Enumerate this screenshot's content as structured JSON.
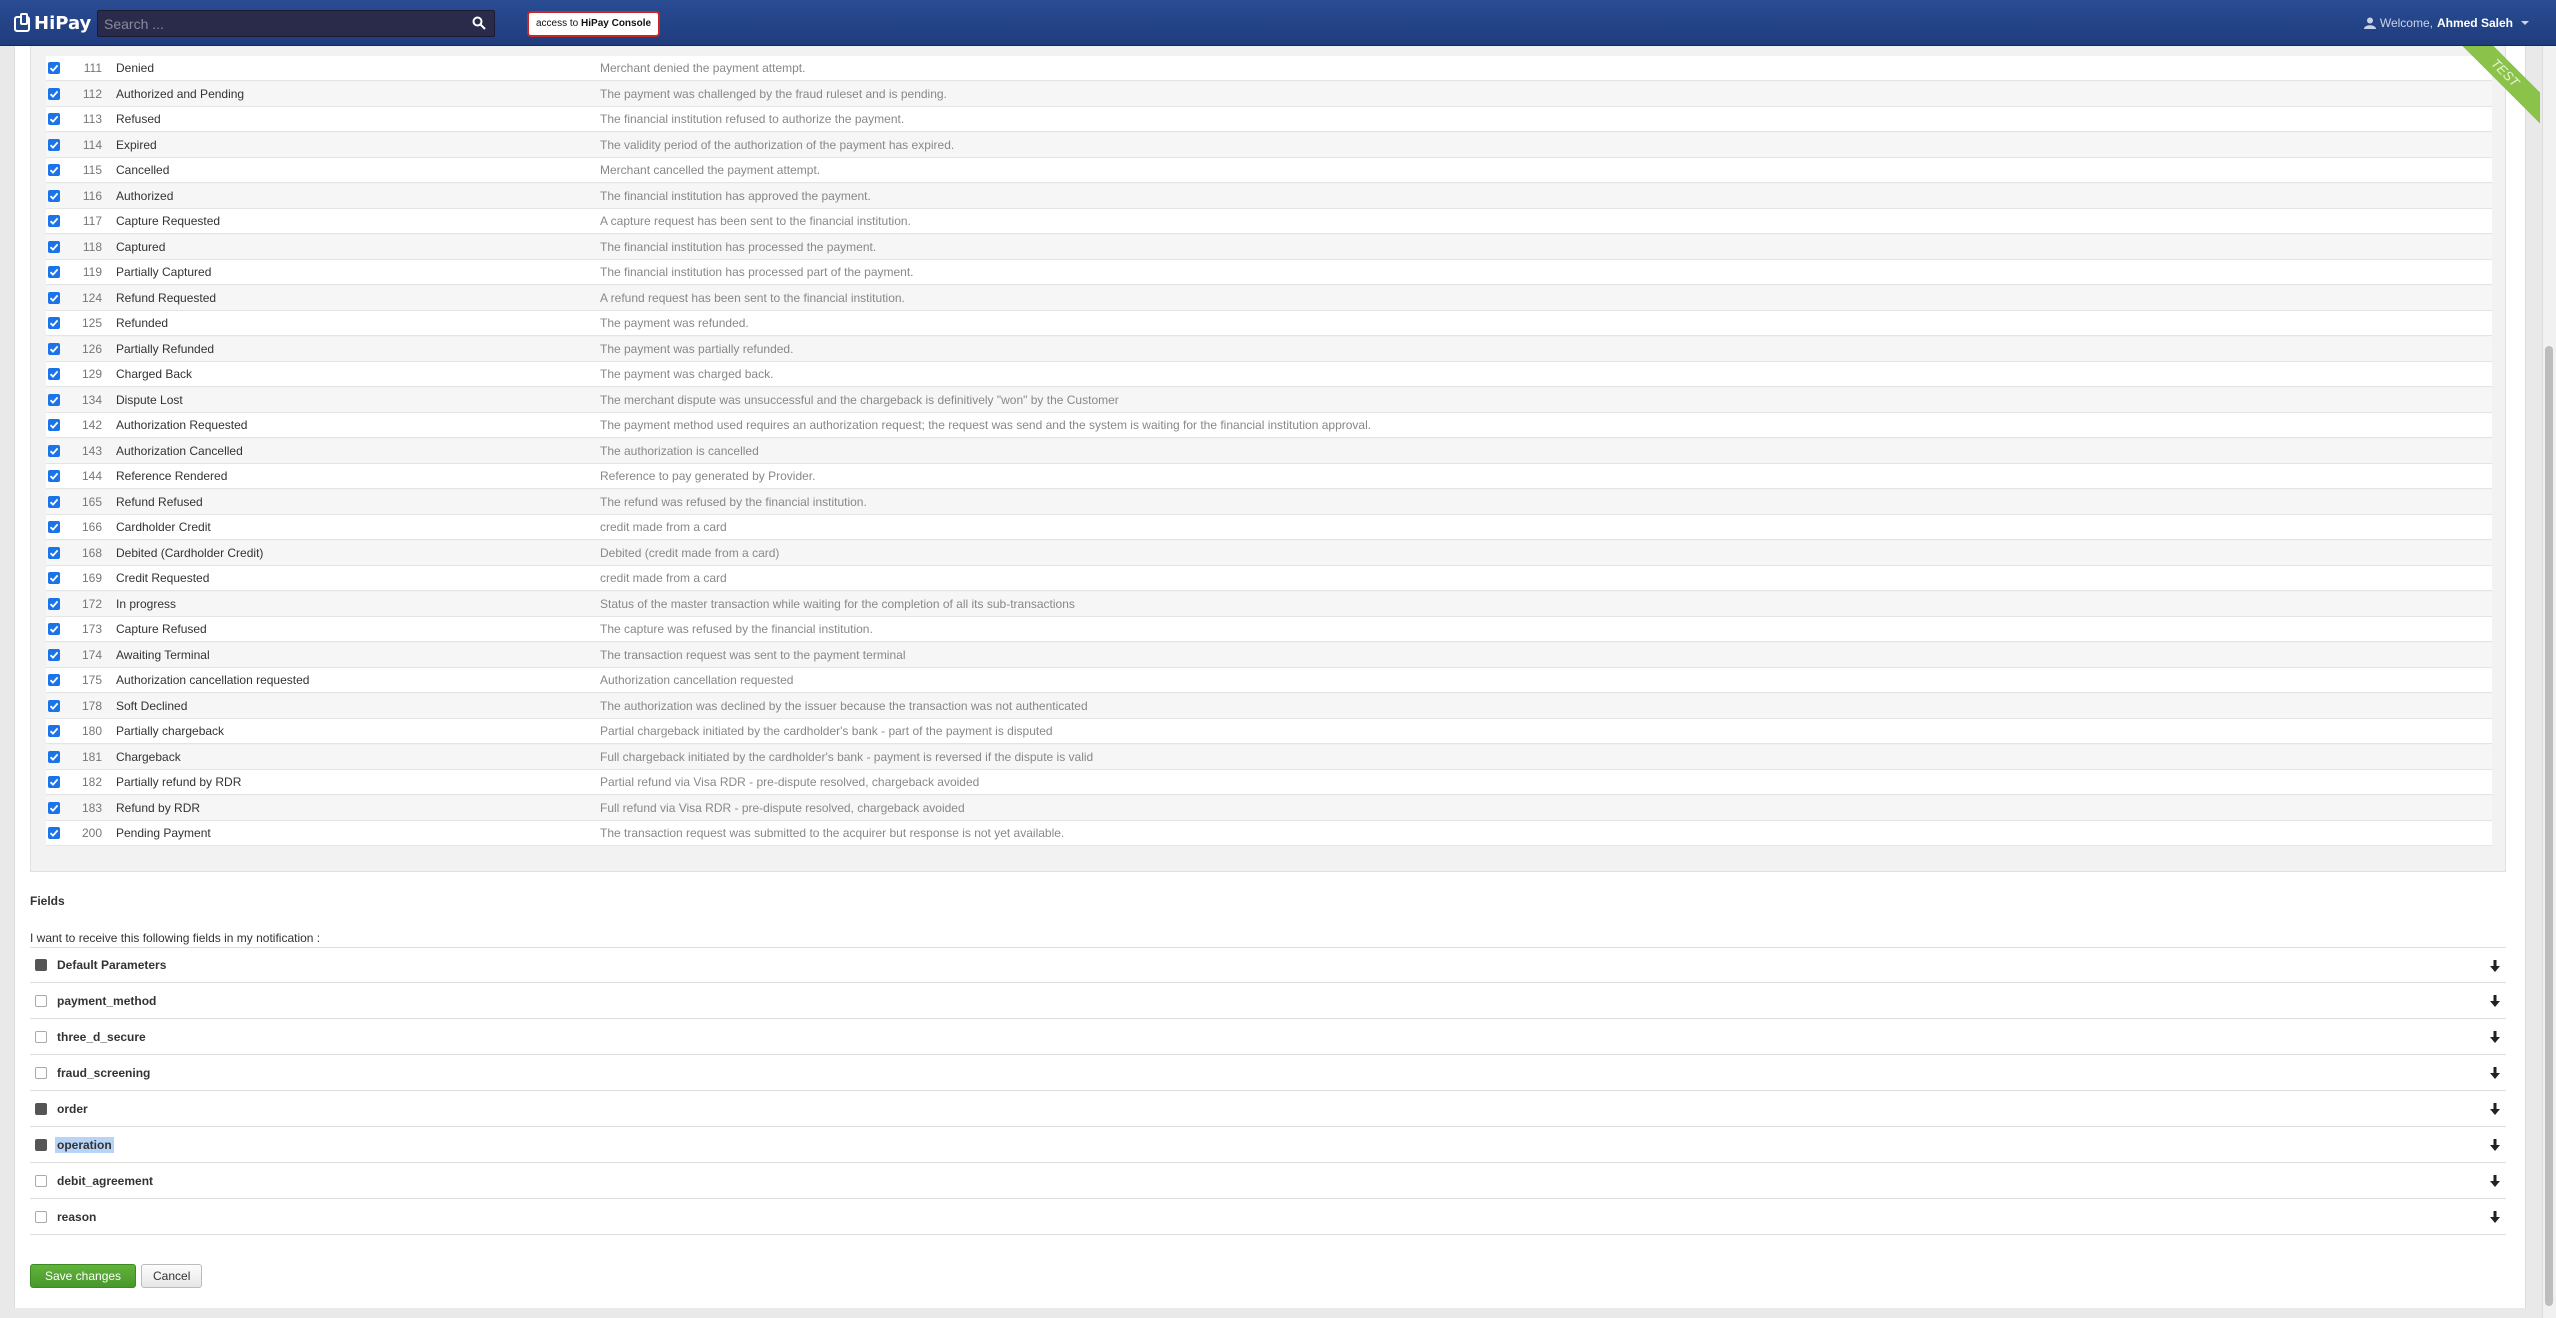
{
  "header": {
    "brand": "HiPay",
    "search_placeholder": "Search ...",
    "console_prefix": "access to ",
    "console_bold": "HiPay Console",
    "welcome": "Welcome,",
    "username": "Ahmed Saleh"
  },
  "ribbon": "TEST",
  "statuses": [
    {
      "code": "111",
      "name": "Denied",
      "desc": "Merchant denied the payment attempt."
    },
    {
      "code": "112",
      "name": "Authorized and Pending",
      "desc": "The payment was challenged by the fraud ruleset and is pending."
    },
    {
      "code": "113",
      "name": "Refused",
      "desc": "The financial institution refused to authorize the payment."
    },
    {
      "code": "114",
      "name": "Expired",
      "desc": "The validity period of the authorization of the payment has expired."
    },
    {
      "code": "115",
      "name": "Cancelled",
      "desc": "Merchant cancelled the payment attempt."
    },
    {
      "code": "116",
      "name": "Authorized",
      "desc": "The financial institution has approved the payment."
    },
    {
      "code": "117",
      "name": "Capture Requested",
      "desc": "A capture request has been sent to the financial institution."
    },
    {
      "code": "118",
      "name": "Captured",
      "desc": "The financial institution has processed the payment."
    },
    {
      "code": "119",
      "name": "Partially Captured",
      "desc": "The financial institution has processed part of the payment."
    },
    {
      "code": "124",
      "name": "Refund Requested",
      "desc": "A refund request has been sent to the financial institution."
    },
    {
      "code": "125",
      "name": "Refunded",
      "desc": "The payment was refunded."
    },
    {
      "code": "126",
      "name": "Partially Refunded",
      "desc": "The payment was partially refunded."
    },
    {
      "code": "129",
      "name": "Charged Back",
      "desc": "The payment was charged back."
    },
    {
      "code": "134",
      "name": "Dispute Lost",
      "desc": "The merchant dispute was unsuccessful and the chargeback is definitively \"won\" by the Customer"
    },
    {
      "code": "142",
      "name": "Authorization Requested",
      "desc": "The payment method used requires an authorization request; the request was send and the system is waiting for the financial institution approval."
    },
    {
      "code": "143",
      "name": "Authorization Cancelled",
      "desc": "The authorization is cancelled"
    },
    {
      "code": "144",
      "name": "Reference Rendered",
      "desc": "Reference to pay generated by Provider."
    },
    {
      "code": "165",
      "name": "Refund Refused",
      "desc": "The refund was refused by the financial institution."
    },
    {
      "code": "166",
      "name": "Cardholder Credit",
      "desc": "credit made from a card"
    },
    {
      "code": "168",
      "name": "Debited (Cardholder Credit)",
      "desc": "Debited (credit made from a card)"
    },
    {
      "code": "169",
      "name": "Credit Requested",
      "desc": "credit made from a card"
    },
    {
      "code": "172",
      "name": "In progress",
      "desc": "Status of the master transaction while waiting for the completion of all its sub-transactions"
    },
    {
      "code": "173",
      "name": "Capture Refused",
      "desc": "The capture was refused by the financial institution."
    },
    {
      "code": "174",
      "name": "Awaiting Terminal",
      "desc": "The transaction request was sent to the payment terminal"
    },
    {
      "code": "175",
      "name": "Authorization cancellation requested",
      "desc": "Authorization cancellation requested"
    },
    {
      "code": "178",
      "name": "Soft Declined",
      "desc": "The authorization was declined by the issuer because the transaction was not authenticated"
    },
    {
      "code": "180",
      "name": "Partially chargeback",
      "desc": "Partial chargeback initiated by the cardholder's bank - part of the payment is disputed"
    },
    {
      "code": "181",
      "name": "Chargeback",
      "desc": "Full chargeback initiated by the cardholder's bank - payment is reversed if the dispute is valid"
    },
    {
      "code": "182",
      "name": "Partially refund by RDR",
      "desc": "Partial refund via Visa RDR - pre-dispute resolved, chargeback avoided"
    },
    {
      "code": "183",
      "name": "Refund by RDR",
      "desc": "Full refund via Visa RDR - pre-dispute resolved, chargeback avoided"
    },
    {
      "code": "200",
      "name": "Pending Payment",
      "desc": "The transaction request was submitted to the acquirer but response is not yet available."
    }
  ],
  "fields": {
    "title": "Fields",
    "intro": "I want to receive this following fields in my notification :",
    "items": [
      {
        "name": "Default Parameters",
        "state": "indeterminate"
      },
      {
        "name": "payment_method",
        "state": "unchecked"
      },
      {
        "name": "three_d_secure",
        "state": "unchecked"
      },
      {
        "name": "fraud_screening",
        "state": "unchecked"
      },
      {
        "name": "order",
        "state": "indeterminate"
      },
      {
        "name": "operation",
        "state": "indeterminate",
        "selected": true
      },
      {
        "name": "debit_agreement",
        "state": "unchecked"
      },
      {
        "name": "reason",
        "state": "unchecked"
      }
    ]
  },
  "actions": {
    "save": "Save changes",
    "cancel": "Cancel"
  },
  "colors": {
    "navbar": "#24468a",
    "checkbox": "#1a73e8",
    "save": "#53a631",
    "ribbon": "#8bc34a"
  }
}
